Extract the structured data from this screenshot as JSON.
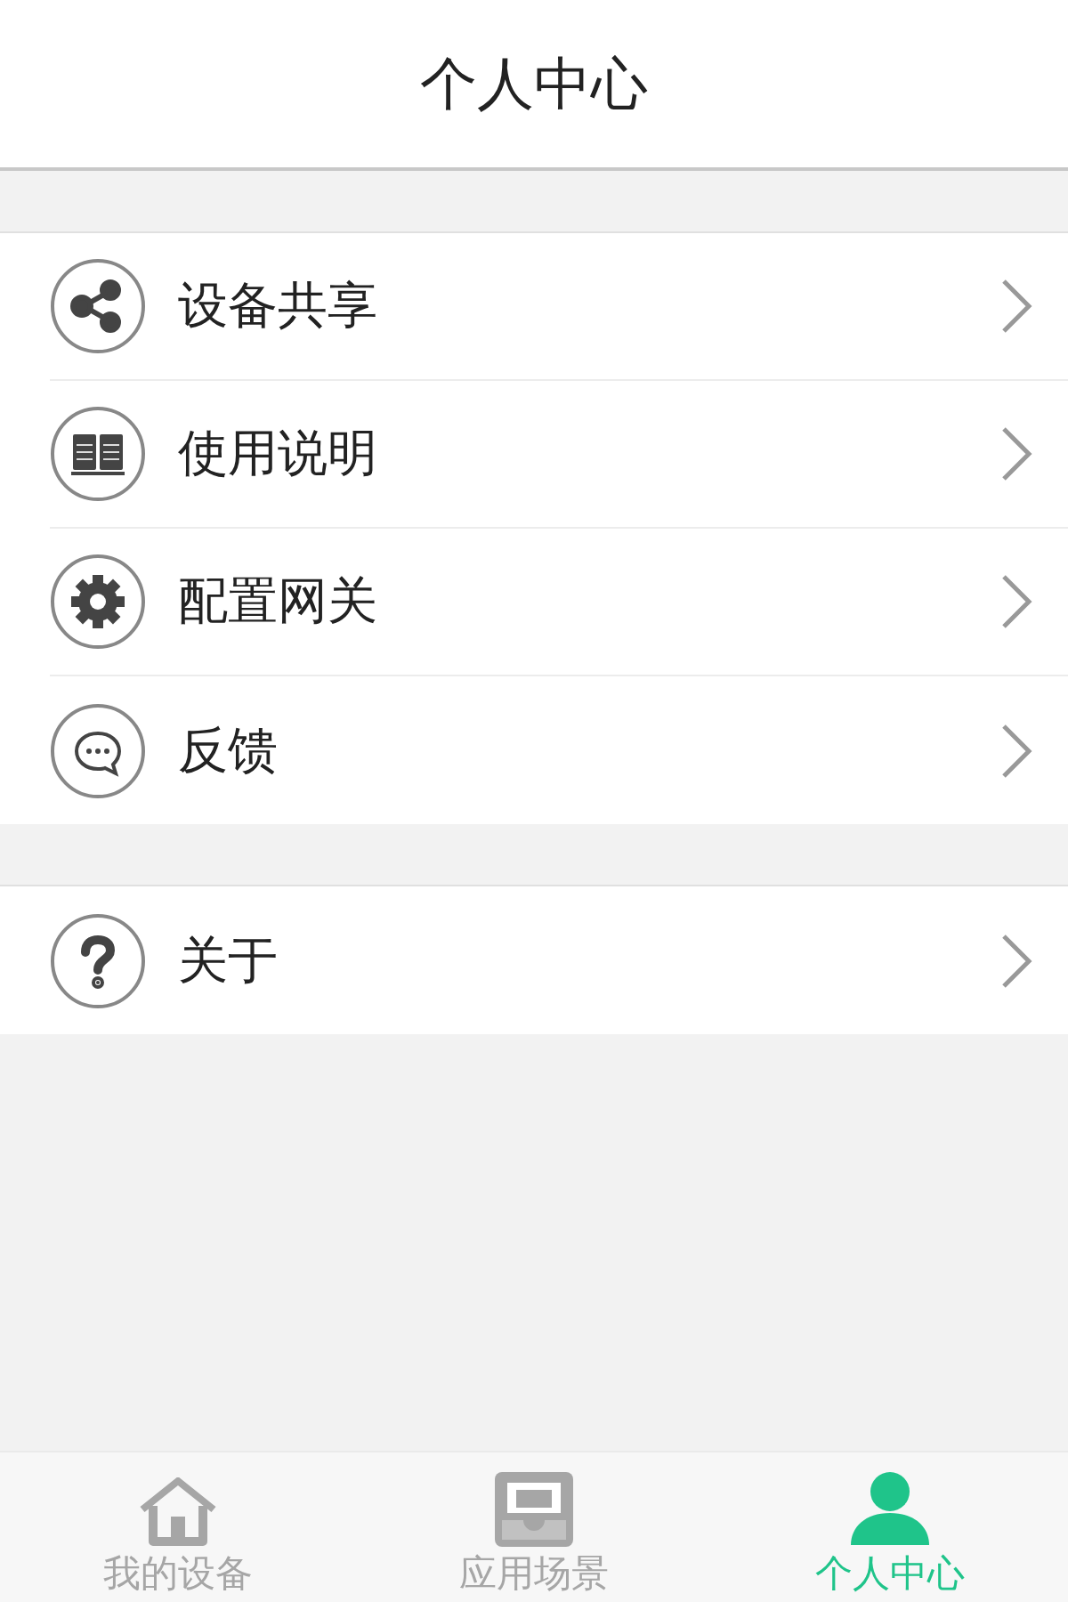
{
  "header": {
    "title": "个人中心"
  },
  "groups": [
    {
      "items": [
        {
          "kind": "share",
          "label": "设备共享"
        },
        {
          "kind": "book",
          "label": "使用说明"
        },
        {
          "kind": "gear",
          "label": "配置网关"
        },
        {
          "kind": "chat",
          "label": "反馈"
        }
      ]
    },
    {
      "items": [
        {
          "kind": "help",
          "label": "关于"
        }
      ]
    }
  ],
  "tab_bar": [
    {
      "kind": "home",
      "label": "我的设备",
      "selected": false
    },
    {
      "kind": "scene",
      "label": "应用场景",
      "selected": false
    },
    {
      "kind": "person",
      "label": "个人中心",
      "selected": true
    }
  ]
}
